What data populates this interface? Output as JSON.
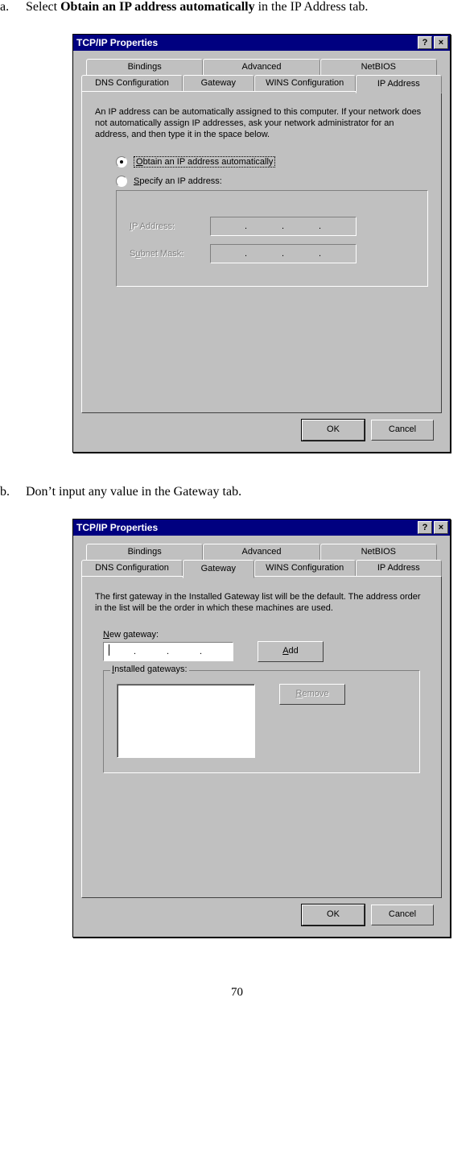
{
  "step_a": {
    "letter": "a.",
    "pre": "Select ",
    "bold": "Obtain an IP address automatically",
    "post": " in the IP Address tab."
  },
  "step_b": {
    "letter": "b.",
    "text": "Don’t input any value in the Gateway tab."
  },
  "dialog1": {
    "title": "TCP/IP Properties",
    "help": "?",
    "close": "×",
    "tabs_row1": [
      "Bindings",
      "Advanced",
      "NetBIOS"
    ],
    "tabs_row2": [
      "DNS Configuration",
      "Gateway",
      "WINS Configuration",
      "IP Address"
    ],
    "active_tab": "IP Address",
    "desc": "An IP address can be automatically assigned to this computer. If your network does not automatically assign IP addresses, ask your network administrator for an address, and then type it in the space below.",
    "radio_auto_pre": "O",
    "radio_auto": "btain an IP address automatically",
    "radio_spec_pre": "S",
    "radio_spec": "pecify an IP address:",
    "ip_label_pre": "I",
    "ip_label": "P Address:",
    "sm_label_pre": "S",
    "sm_label_mid": "u",
    "sm_label_post": "bnet Mask:",
    "ok": "OK",
    "cancel": "Cancel"
  },
  "dialog2": {
    "title": "TCP/IP Properties",
    "help": "?",
    "close": "×",
    "tabs_row1": [
      "Bindings",
      "Advanced",
      "NetBIOS"
    ],
    "tabs_row2": [
      "DNS Configuration",
      "Gateway",
      "WINS Configuration",
      "IP Address"
    ],
    "active_tab": "Gateway",
    "desc": "The first gateway in the Installed Gateway list will be the default. The address order in the list will be the order in which these machines are used.",
    "new_gw_pre": "N",
    "new_gw": "ew gateway:",
    "add_pre": "A",
    "add": "dd",
    "installed_pre": "I",
    "installed": "nstalled gateways:",
    "remove_pre": "R",
    "remove": "emove",
    "ok": "OK",
    "cancel": "Cancel"
  },
  "page_number": "70"
}
